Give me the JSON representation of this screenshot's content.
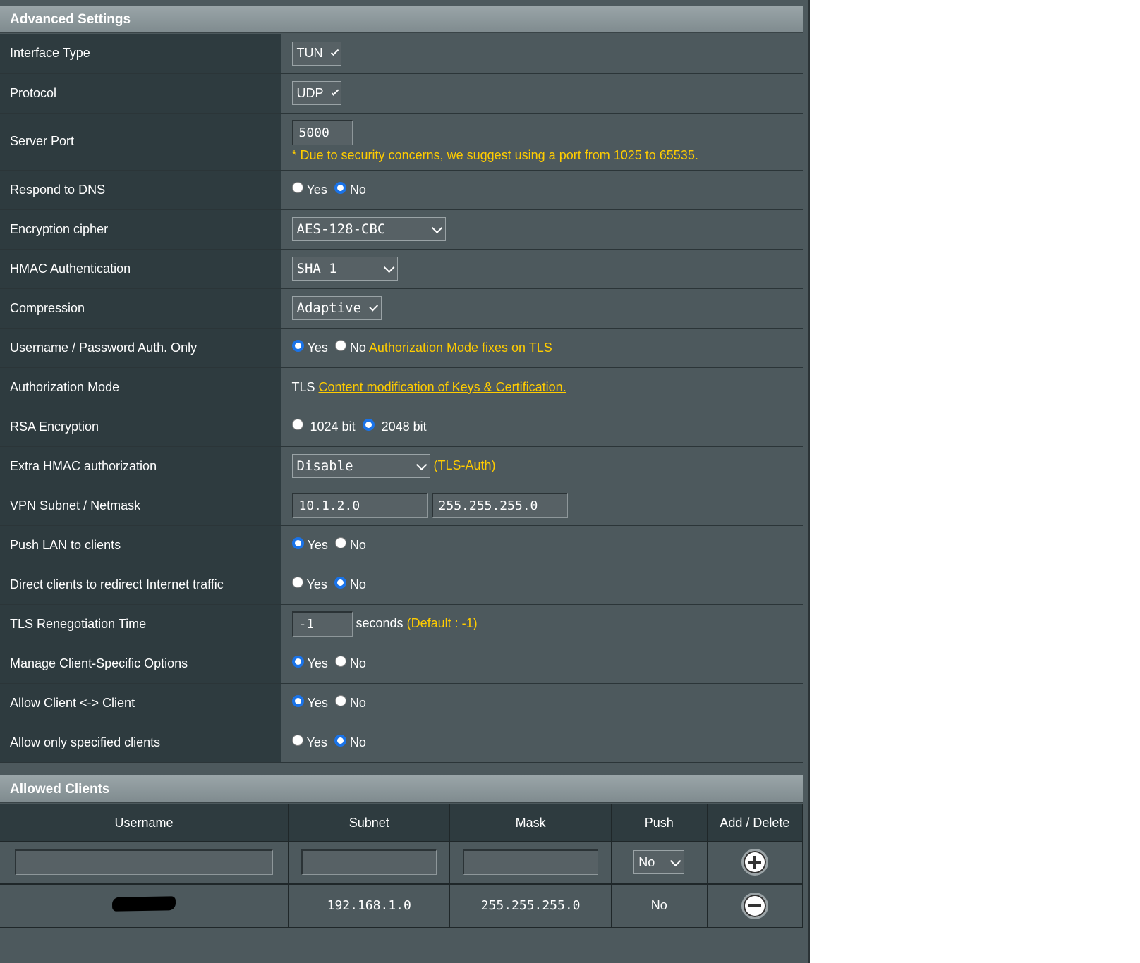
{
  "advanced": {
    "title": "Advanced Settings",
    "interface_type": {
      "label": "Interface Type",
      "value": "TUN"
    },
    "protocol": {
      "label": "Protocol",
      "value": "UDP"
    },
    "server_port": {
      "label": "Server Port",
      "value": "5000",
      "note": "* Due to security concerns, we suggest using a port from 1025 to 65535."
    },
    "respond_dns": {
      "label": "Respond to DNS",
      "yes": "Yes",
      "no": "No",
      "selected": "No"
    },
    "encryption_cipher": {
      "label": "Encryption cipher",
      "value": "AES-128-CBC"
    },
    "hmac_auth": {
      "label": "HMAC Authentication",
      "value": "SHA 1"
    },
    "compression": {
      "label": "Compression",
      "value": "Adaptive"
    },
    "user_pass_only": {
      "label": "Username / Password Auth. Only",
      "yes": "Yes",
      "no": "No",
      "selected": "Yes",
      "note": "Authorization Mode fixes on TLS"
    },
    "auth_mode": {
      "label": "Authorization Mode",
      "value": "TLS",
      "link": "Content modification of Keys & Certification."
    },
    "rsa": {
      "label": "RSA Encryption",
      "opt1": "1024 bit",
      "opt2": "2048 bit",
      "selected": "2048 bit"
    },
    "extra_hmac": {
      "label": "Extra HMAC authorization",
      "value": "Disable",
      "note": "(TLS-Auth)"
    },
    "vpn_subnet": {
      "label": "VPN Subnet / Netmask",
      "subnet": "10.1.2.0",
      "netmask": "255.255.255.0"
    },
    "push_lan": {
      "label": "Push LAN to clients",
      "yes": "Yes",
      "no": "No",
      "selected": "Yes"
    },
    "redirect": {
      "label": "Direct clients to redirect Internet traffic",
      "yes": "Yes",
      "no": "No",
      "selected": "No"
    },
    "tls_reneg": {
      "label": "TLS Renegotiation Time",
      "value": "-1",
      "unit": "seconds",
      "note": "(Default : -1)"
    },
    "ccd": {
      "label": "Manage Client-Specific Options",
      "yes": "Yes",
      "no": "No",
      "selected": "Yes"
    },
    "c2c": {
      "label": "Allow Client <-> Client",
      "yes": "Yes",
      "no": "No",
      "selected": "Yes"
    },
    "only_specified": {
      "label": "Allow only specified clients",
      "yes": "Yes",
      "no": "No",
      "selected": "No"
    }
  },
  "clients": {
    "title": "Allowed Clients",
    "headers": {
      "username": "Username",
      "subnet": "Subnet",
      "mask": "Mask",
      "push": "Push",
      "add_delete": "Add / Delete"
    },
    "new_row": {
      "push": "No"
    },
    "rows": [
      {
        "subnet": "192.168.1.0",
        "mask": "255.255.255.0",
        "push": "No"
      }
    ]
  },
  "colors": {
    "accent_note": "#ffcc00",
    "radio_selected": "#1a73e8",
    "panel": "#4d595d",
    "label_bg": "#2e3b3f"
  }
}
